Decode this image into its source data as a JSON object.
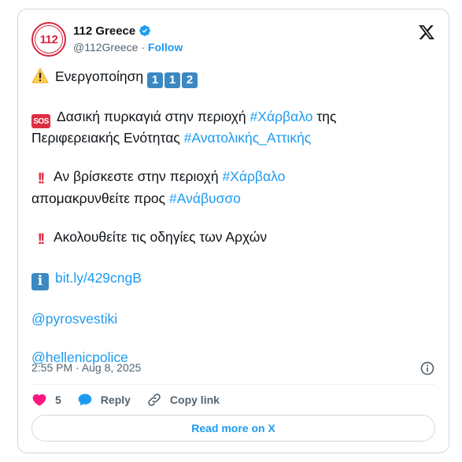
{
  "author": {
    "name": "112 Greece",
    "handle": "@112Greece",
    "separator": "·",
    "follow_label": "Follow",
    "avatar_text": "112",
    "verified": true
  },
  "tweet": {
    "line1_text": "Ενεργοποίηση",
    "keycaps": [
      "1",
      "1",
      "2"
    ],
    "sos_label": "SOS",
    "line2_text": "Δασική πυρκαγιά στην περιοχή",
    "line2_tag": "#Χάρβαλο",
    "line2_tail": "της",
    "line3_text": "Περιφερειακής Ενότητας",
    "line3_tag": "#Ανατολικής_Αττικής",
    "bang_glyph": "!!",
    "line4_text": "Αν βρίσκεστε στην περιοχή",
    "line4_tag": "#Χάρβαλο",
    "line5_text": "απομακρυνθείτε προς",
    "line5_tag": "#Ανάβυσσο",
    "line6_text": "Ακολουθείτε τις οδηγίες των Αρχών",
    "info_glyph": "i",
    "link": "bit.ly/429cngB",
    "mention1": "@pyrosvestiki",
    "mention2": "@hellenicpolice"
  },
  "meta": {
    "timestamp": "2:55 PM · Aug 8, 2025"
  },
  "actions": {
    "likes": "5",
    "reply_label": "Reply",
    "copy_label": "Copy link"
  },
  "read_more_label": "Read more on X",
  "colors": {
    "accent": "#1d9bf0",
    "text": "#0f1419",
    "muted": "#536471",
    "like": "#f91880",
    "keycap": "#3b88c3",
    "sos": "#dd2e44"
  },
  "icons": [
    "verified-badge-icon",
    "x-logo-icon",
    "warning-icon",
    "keycap-icon",
    "sos-icon",
    "double-exclamation-icon",
    "information-icon",
    "info-icon",
    "heart-icon",
    "reply-icon",
    "copy-link-icon"
  ]
}
